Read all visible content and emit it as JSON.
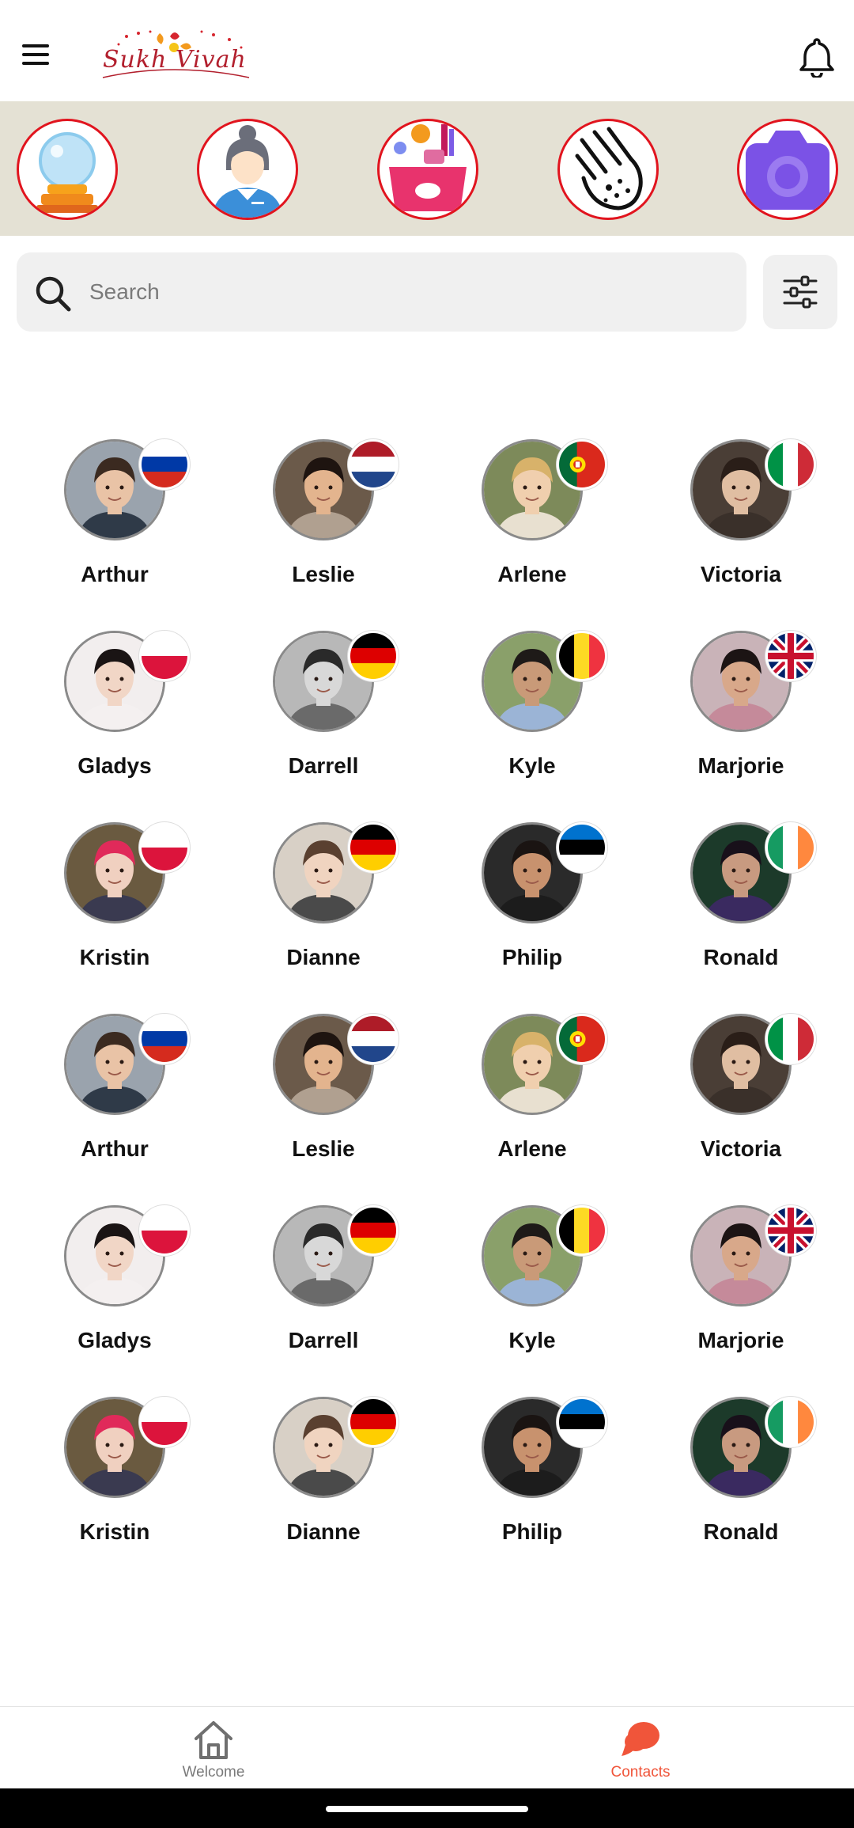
{
  "header": {
    "logo_text": "Sukh Vivah",
    "menu_icon": "hamburger-menu-icon",
    "notification_icon": "bell-icon"
  },
  "stories": [
    {
      "icon": "crystal-ball-icon"
    },
    {
      "icon": "woman-avatar-icon"
    },
    {
      "icon": "makeup-kit-icon"
    },
    {
      "icon": "palm-reading-icon"
    },
    {
      "icon": "camera-icon"
    }
  ],
  "search": {
    "placeholder": "Search",
    "value": "",
    "filter_icon": "sliders-icon"
  },
  "profiles": [
    {
      "name": "Arthur",
      "flag": "russia"
    },
    {
      "name": "Leslie",
      "flag": "netherlands"
    },
    {
      "name": "Arlene",
      "flag": "portugal"
    },
    {
      "name": "Victoria",
      "flag": "italy"
    },
    {
      "name": "Gladys",
      "flag": "poland"
    },
    {
      "name": "Darrell",
      "flag": "germany"
    },
    {
      "name": "Kyle",
      "flag": "belgium"
    },
    {
      "name": "Marjorie",
      "flag": "united-kingdom"
    },
    {
      "name": "Kristin",
      "flag": "poland"
    },
    {
      "name": "Dianne",
      "flag": "germany"
    },
    {
      "name": "Philip",
      "flag": "estonia"
    },
    {
      "name": "Ronald",
      "flag": "ireland"
    },
    {
      "name": "Arthur",
      "flag": "russia"
    },
    {
      "name": "Leslie",
      "flag": "netherlands"
    },
    {
      "name": "Arlene",
      "flag": "portugal"
    },
    {
      "name": "Victoria",
      "flag": "italy"
    },
    {
      "name": "Gladys",
      "flag": "poland"
    },
    {
      "name": "Darrell",
      "flag": "germany"
    },
    {
      "name": "Kyle",
      "flag": "belgium"
    },
    {
      "name": "Marjorie",
      "flag": "united-kingdom"
    },
    {
      "name": "Kristin",
      "flag": "poland"
    },
    {
      "name": "Dianne",
      "flag": "germany"
    },
    {
      "name": "Philip",
      "flag": "estonia"
    },
    {
      "name": "Ronald",
      "flag": "ireland"
    }
  ],
  "bottom_nav": {
    "welcome_label": "Welcome",
    "contacts_label": "Contacts",
    "active": "contacts"
  },
  "colors": {
    "accent": "#f0553a",
    "story_ring": "#e1141e",
    "stories_bg": "#e4e1d4",
    "search_bg": "#f0f0f0"
  }
}
